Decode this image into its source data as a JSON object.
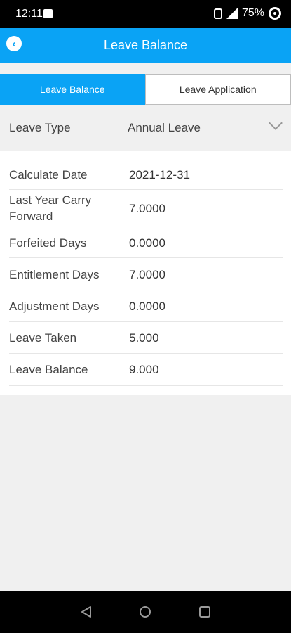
{
  "status_bar": {
    "time": "12:11",
    "battery": "75%"
  },
  "header": {
    "title": "Leave Balance"
  },
  "tabs": [
    {
      "label": "Leave Balance",
      "active": true
    },
    {
      "label": "Leave Application",
      "active": false
    }
  ],
  "leave_type": {
    "label": "Leave Type",
    "value": "Annual Leave"
  },
  "details": [
    {
      "label": "Calculate Date",
      "value": "2021-12-31"
    },
    {
      "label": "Last Year Carry Forward",
      "value": "7.0000"
    },
    {
      "label": "Forfeited Days",
      "value": "0.0000"
    },
    {
      "label": "Entitlement Days",
      "value": "7.0000"
    },
    {
      "label": "Adjustment Days",
      "value": "0.0000"
    },
    {
      "label": "Leave Taken",
      "value": "5.000"
    },
    {
      "label": "Leave Balance",
      "value": "9.000"
    }
  ],
  "colors": {
    "accent": "#0aa3f5"
  }
}
